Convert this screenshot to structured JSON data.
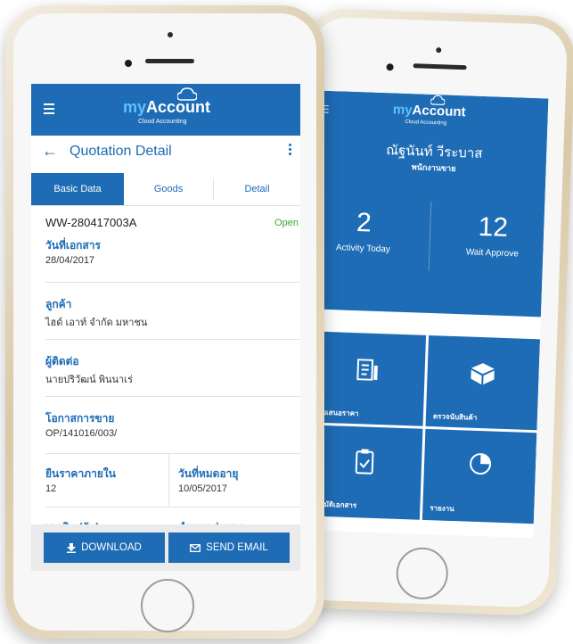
{
  "brand": {
    "name_my": "my",
    "name_account": "Account",
    "subtitle": "Cloud Accounting"
  },
  "dashboard": {
    "user_name": "ณัฐนันท์ วีระบาส",
    "user_role": "พนักงานขาย",
    "stats": [
      {
        "value": "2",
        "label": "Activity Today"
      },
      {
        "value": "12",
        "label": "Wait Approve"
      }
    ],
    "tiles": [
      {
        "label": "ใบเสนอราคา",
        "icon": "document-icon"
      },
      {
        "label": "ตรวจนับสินค้า",
        "icon": "box-icon"
      },
      {
        "label": "อนุมัติเอกสาร",
        "icon": "clipboard-check-icon"
      },
      {
        "label": "รายงาน",
        "icon": "pie-chart-icon"
      }
    ]
  },
  "detail": {
    "title": "Quotation Detail",
    "tabs": [
      {
        "label": "Basic Data"
      },
      {
        "label": "Goods"
      },
      {
        "label": "Detail"
      }
    ],
    "doc_number": "WW-280417003A",
    "status": "Open",
    "fields": [
      {
        "label": "วันที่เอกสาร",
        "value": "28/04/2017"
      },
      {
        "label": "ลูกค้า",
        "value": "ไฮด์ เอาท์ จำกัด มหาชน"
      },
      {
        "label": "ผู้ติดต่อ",
        "value": "นายปริวัฒน์ พินนาเร่"
      },
      {
        "label": "โอกาสการขาย",
        "value": "OP/141016/003/"
      }
    ],
    "pair": [
      {
        "label": "ยืนราคาภายใน",
        "value": "12"
      },
      {
        "label": "วันที่หมดอายุ",
        "value": "10/05/2017"
      }
    ],
    "partial_labels": [
      "เครดิต (วัน)",
      "กำหนดส่งของ"
    ],
    "buttons": {
      "download": "DOWNLOAD",
      "send_email": "SEND EMAIL"
    }
  },
  "colors": {
    "primary": "#1e6cb5",
    "status_open": "#3aaa35"
  }
}
